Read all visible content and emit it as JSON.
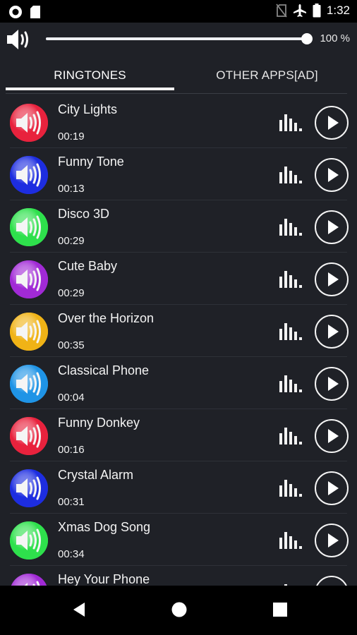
{
  "status_bar": {
    "time": "1:32"
  },
  "volume": {
    "level_percent": 100,
    "label": "100 %"
  },
  "tabs": [
    {
      "label": "RINGTONES",
      "selected": true
    },
    {
      "label": "OTHER APPS[AD]",
      "selected": false
    }
  ],
  "ringtones": [
    {
      "title": "City Lights",
      "duration": "00:19",
      "color": "#e8223d"
    },
    {
      "title": "Funny Tone",
      "duration": "00:13",
      "color": "#1d2de0"
    },
    {
      "title": "Disco 3D",
      "duration": "00:29",
      "color": "#2ee04c"
    },
    {
      "title": "Cute Baby",
      "duration": "00:29",
      "color": "#a12ad6"
    },
    {
      "title": "Over the Horizon",
      "duration": "00:35",
      "color": "#f0b316"
    },
    {
      "title": "Classical Phone",
      "duration": "00:04",
      "color": "#1f94e6"
    },
    {
      "title": "Funny Donkey",
      "duration": "00:16",
      "color": "#e8223d"
    },
    {
      "title": "Crystal Alarm",
      "duration": "00:31",
      "color": "#1d2de0"
    },
    {
      "title": "Xmas Dog Song",
      "duration": "00:34",
      "color": "#2ee04c"
    },
    {
      "title": "Hey Your Phone",
      "duration": "",
      "color": "#a12ad6"
    }
  ],
  "icons": {
    "status_left": [
      "record-icon",
      "sd-card-icon"
    ],
    "status_right": [
      "no-sim-icon",
      "airplane-icon",
      "battery-icon"
    ],
    "volume": "speaker-icon",
    "row_visualizer": "equalizer-bars-icon",
    "row_play": "play-icon",
    "nav": [
      "back-icon",
      "home-icon",
      "recents-icon"
    ]
  },
  "colors": {
    "background": "#1f2127",
    "accent": "#ffffff"
  }
}
